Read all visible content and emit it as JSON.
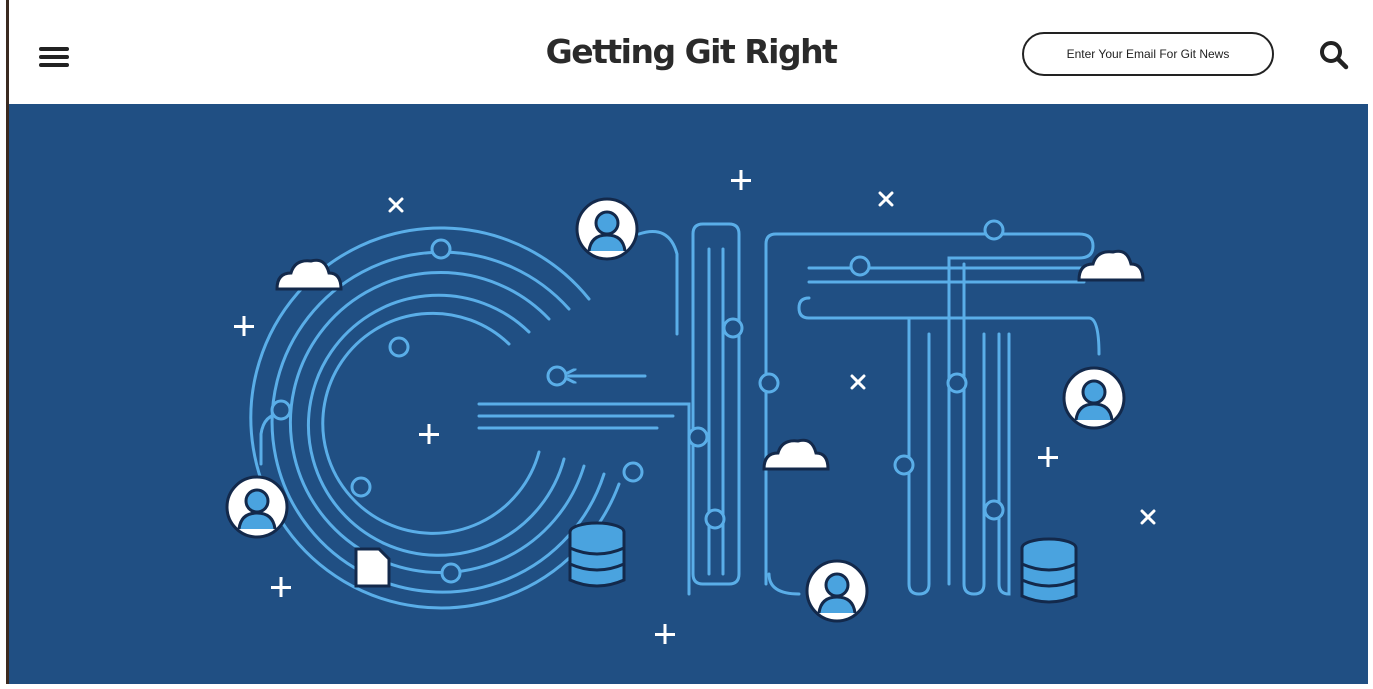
{
  "header": {
    "title": "Getting Git Right",
    "email_placeholder": "Enter Your Email For Git News"
  },
  "icons": {
    "menu": "hamburger-menu-icon",
    "search": "search-icon"
  },
  "colors": {
    "hero_bg": "#204f83",
    "line": "#5aaee8",
    "text_dark": "#2a2a2a",
    "accent_rule": "#3b2a20"
  },
  "hero": {
    "illustration": "git-branching-illustration"
  }
}
